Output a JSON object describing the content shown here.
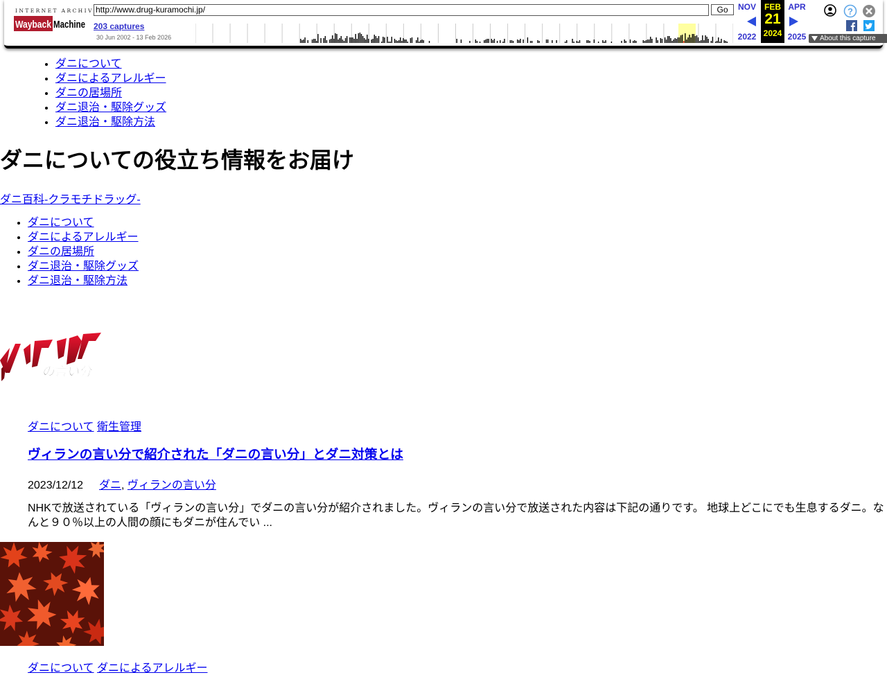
{
  "wayback": {
    "logo_top": "INTERNET ARCHIVE",
    "logo_main": "WaybackMachine",
    "url": "http://www.drug-kuramochi.jp/",
    "go_label": "Go",
    "captures_label": "203 captures",
    "date_range": "30 Jun 2002 - 13 Feb 2026",
    "prev_month": "NOV",
    "prev_year": "2022",
    "cur_month": "FEB",
    "cur_day": "21",
    "cur_year": "2024",
    "next_month": "APR",
    "next_year": "2025",
    "about_label": "About this capture",
    "icons": [
      "user-icon",
      "help-icon",
      "close-icon",
      "facebook-icon",
      "twitter-icon"
    ]
  },
  "nav": {
    "items": [
      "ダニについて",
      "ダニによるアレルギー",
      "ダニの居場所",
      "ダニ退治・駆除グッズ",
      "ダニ退治・駆除方法"
    ]
  },
  "site": {
    "title": "ダニについての役立ち情報をお届け",
    "subtitle": "ダニ百科-クラモチドラッグ-"
  },
  "post1": {
    "image_text": "ヴィランの言い分",
    "categories": [
      "ダニについて",
      "衛生管理"
    ],
    "title": "ヴィランの言い分で紹介された「ダニの言い分」とダニ対策とは",
    "date": "2023/12/12",
    "tags": [
      "ダニ",
      "ヴィランの言い分"
    ],
    "excerpt": "NHKで放送されている「ヴィランの言い分」でダニの言い分が紹介されました。ヴィランの言い分で放送された内容は下記の通りです。 地球上どこにでも生息するダニ。なんと９０％以上の人間の顔にもダニが住んでい ..."
  },
  "post2": {
    "categories": [
      "ダニについて",
      "ダニによるアレルギー"
    ]
  },
  "colors": {
    "link": "#0000ee",
    "wayback_link": "#3333cc",
    "current_date_bg": "#000000",
    "current_date_fg": "#ffff00",
    "villain_red": "#c8102e"
  }
}
